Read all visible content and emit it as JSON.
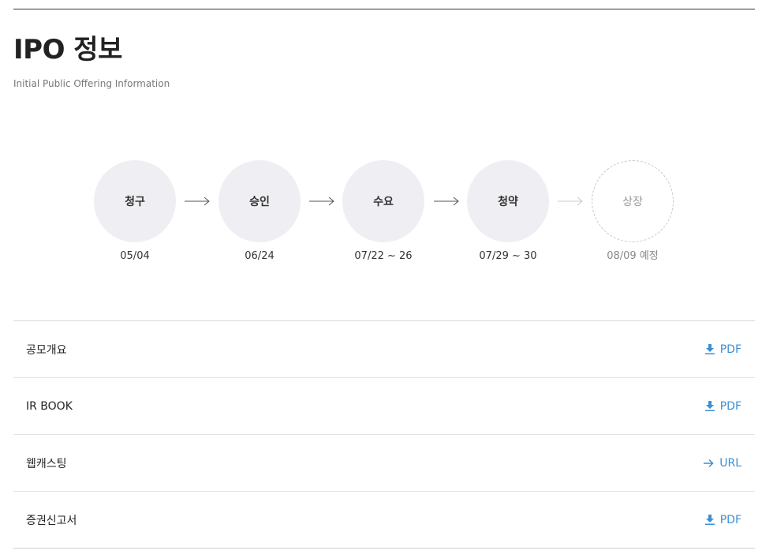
{
  "header": {
    "title": "IPO 정보",
    "subtitle": "Initial Public Offering Information"
  },
  "timeline": {
    "steps": [
      {
        "label": "청구",
        "date": "05/04",
        "status": "done"
      },
      {
        "label": "승인",
        "date": "06/24",
        "status": "done"
      },
      {
        "label": "수요",
        "date": "07/22 ~ 26",
        "status": "done"
      },
      {
        "label": "청약",
        "date": "07/29 ~ 30",
        "status": "done"
      },
      {
        "label": "상장",
        "date": "08/09 예정",
        "status": "pending"
      }
    ]
  },
  "documents": [
    {
      "label": "공모개요",
      "link_text": "PDF",
      "icon": "download-icon"
    },
    {
      "label": "IR BOOK",
      "link_text": "PDF",
      "icon": "download-icon"
    },
    {
      "label": "웹캐스팅",
      "link_text": "URL",
      "icon": "arrow-right-icon"
    },
    {
      "label": "증권신고서",
      "link_text": "PDF",
      "icon": "download-icon"
    }
  ],
  "colors": {
    "accent": "#3b8fd6",
    "circle": "#efeff3",
    "text": "#222222",
    "muted": "#888888"
  }
}
